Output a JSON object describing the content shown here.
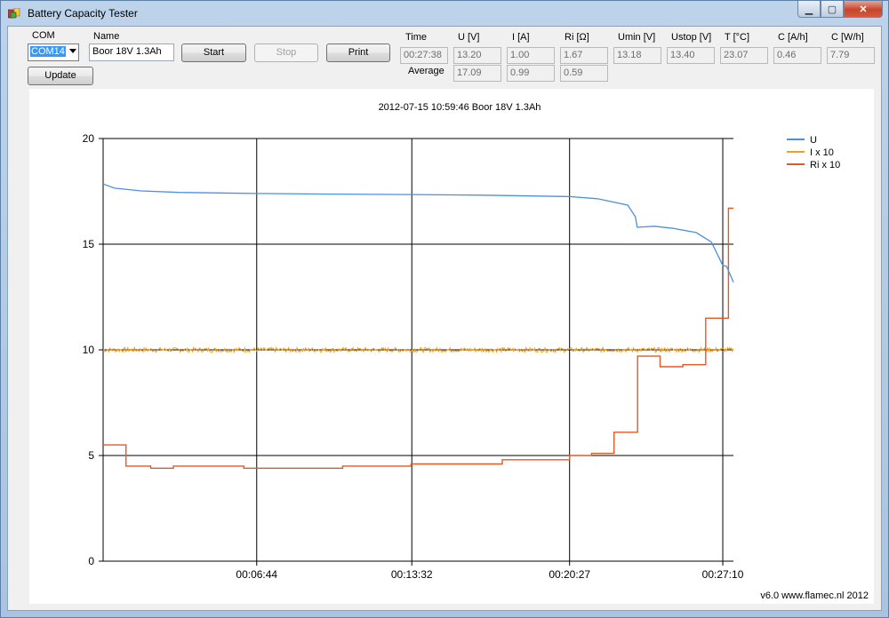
{
  "window": {
    "title": "Battery Capacity Tester"
  },
  "controls": {
    "com_label": "COM",
    "com_value": "COM14",
    "name_label": "Name",
    "name_value": "Boor 18V 1.3Ah",
    "start": "Start",
    "stop": "Stop",
    "print": "Print",
    "update": "Update"
  },
  "readouts": {
    "time_label": "Time",
    "average_label": "Average",
    "columns": [
      {
        "label": "U [V]",
        "current": "13.20",
        "average": "17.09"
      },
      {
        "label": "I [A]",
        "current": "1.00",
        "average": "0.99"
      },
      {
        "label": "Ri [Ω]",
        "current": "1.67",
        "average": "0.59"
      },
      {
        "label": "Umin [V]",
        "current": "13.18"
      },
      {
        "label": "Ustop [V]",
        "current": "13.40"
      },
      {
        "label": "T [°C]",
        "current": "23.07"
      },
      {
        "label": "C [A/h]",
        "current": "0.46"
      },
      {
        "label": "C [W/h]",
        "current": "7.79"
      }
    ],
    "time_value": "00:27:38"
  },
  "footer": "v6.0   www.flamec.nl   2012",
  "chart_data": {
    "type": "line",
    "title": "2012-07-15 10:59:46 Boor 18V 1.3Ah",
    "xlabel": "",
    "ylabel": "",
    "ylim": [
      0,
      20
    ],
    "xlim_seconds": [
      0,
      1658
    ],
    "x_tick_labels": [
      "00:06:44",
      "00:13:32",
      "00:20:27",
      "00:27:10"
    ],
    "x_tick_seconds": [
      404,
      812,
      1227,
      1630
    ],
    "y_ticks": [
      0,
      5,
      10,
      15,
      20
    ],
    "grid": true,
    "legend_position": "top-right",
    "series": [
      {
        "name": "U",
        "color": "#4a90e2",
        "x": [
          0,
          30,
          100,
          200,
          404,
          600,
          812,
          1000,
          1227,
          1300,
          1380,
          1400,
          1405,
          1450,
          1500,
          1560,
          1600,
          1630,
          1640,
          1658
        ],
        "values": [
          17.85,
          17.65,
          17.52,
          17.45,
          17.4,
          17.37,
          17.35,
          17.32,
          17.25,
          17.15,
          16.85,
          16.3,
          15.8,
          15.85,
          15.75,
          15.55,
          15.1,
          14.0,
          13.95,
          13.2
        ]
      },
      {
        "name": "I x 10",
        "color": "#f0a020",
        "x": [
          0,
          1658
        ],
        "values": [
          10.0,
          10.0
        ]
      },
      {
        "name": "Ri x 10",
        "color": "#e05a28",
        "x": [
          0,
          60,
          60,
          125,
          125,
          185,
          185,
          370,
          370,
          630,
          630,
          810,
          810,
          1050,
          1050,
          1227,
          1227,
          1285,
          1285,
          1344,
          1344,
          1406,
          1406,
          1465,
          1465,
          1525,
          1525,
          1585,
          1585,
          1645,
          1645,
          1658
        ],
        "values": [
          5.5,
          5.5,
          4.5,
          4.5,
          4.4,
          4.4,
          4.5,
          4.5,
          4.4,
          4.4,
          4.5,
          4.5,
          4.6,
          4.6,
          4.8,
          4.8,
          5.0,
          5.0,
          5.1,
          5.1,
          6.1,
          6.1,
          9.7,
          9.7,
          9.2,
          9.2,
          9.3,
          9.3,
          11.5,
          11.5,
          16.7,
          16.7
        ]
      }
    ]
  }
}
